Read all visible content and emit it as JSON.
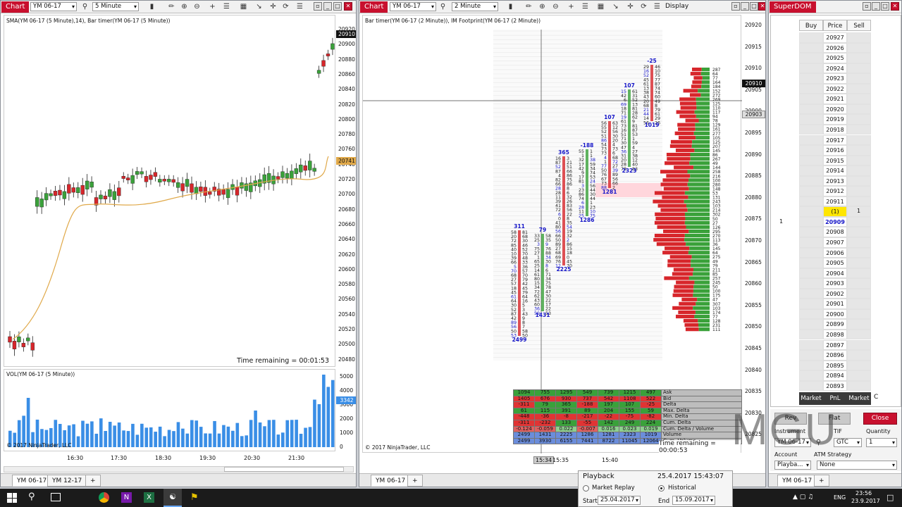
{
  "colors": {
    "accent": "#c8102e",
    "up": "#3aa13a",
    "down": "#d7262b",
    "sma": "#e0a94a",
    "vol": "#3a8ee6",
    "dom_highlight": "#ffe600"
  },
  "chart1": {
    "tag": "Chart",
    "instrument": "YM 06-17",
    "interval": "5 Minute",
    "indicators": "SMA(YM 06-17 (5 Minute),14), Bar timer(YM 06-17 (5 Minute))",
    "time_remaining": "Time remaining = 00:01:53",
    "price_ticks": [
      "20920",
      "20900",
      "20880",
      "20860",
      "20840",
      "20820",
      "20800",
      "20780",
      "20760",
      "20740",
      "20720",
      "20700",
      "20680",
      "20660",
      "20640",
      "20620",
      "20600",
      "20580",
      "20560",
      "20540",
      "20520",
      "20500",
      "20480"
    ],
    "last_price": "20910",
    "sma_price": "20741",
    "vol_title": "VOL(YM 06-17 (5 Minute))",
    "vol_ticks": [
      "5000",
      "4000",
      "3000",
      "2000",
      "1000",
      "0"
    ],
    "vol_last": "3342",
    "copyright": "© 2017 NinjaTrader, LLC",
    "time_ticks": [
      "16:30",
      "17:30",
      "18:30",
      "19:30",
      "20:30",
      "21:30"
    ],
    "tabs": [
      "YM 06-17",
      "YM 12-17"
    ]
  },
  "chart2": {
    "tag": "Chart",
    "instrument": "YM 06-17",
    "interval": "2 Minute",
    "display_label": "Display",
    "indicators": "Bar timer(YM 06-17 (2 Minute)),  IM Footprint(YM 06-17 (2 Minute))",
    "price_ticks": [
      "20920",
      "20915",
      "20910",
      "20905",
      "20900",
      "20895",
      "20890",
      "20885",
      "20880",
      "20875",
      "20870",
      "20865",
      "20860",
      "20855",
      "20850",
      "20845",
      "20840",
      "20835",
      "20830",
      "20825"
    ],
    "last_price": "20910",
    "cursor_price": "20903",
    "time_remaining": "Time remaining = 00:00:53",
    "copyright": "© 2017 NinjaTrader, LLC",
    "time_ticks": [
      "15:34",
      "15:35",
      "15:40"
    ],
    "stats_labels": [
      "Ask",
      "Bid",
      "Delta",
      "Max. Delta",
      "Min. Delta",
      "Cum. Delta",
      "Cum. Delta / Volume",
      "Volume",
      "Cum. Volume"
    ],
    "stats_rows": [
      [
        "1094",
        "755",
        "1295",
        "549",
        "739",
        "1215",
        "497"
      ],
      [
        "1405",
        "676",
        "930",
        "737",
        "542",
        "1108",
        "522"
      ],
      [
        "-311",
        "79",
        "365",
        "-188",
        "197",
        "107",
        "-25"
      ],
      [
        "61",
        "115",
        "391",
        "89",
        "204",
        "155",
        "59"
      ],
      [
        "-448",
        "-36",
        "-8",
        "-217",
        "-22",
        "-75",
        "-82"
      ],
      [
        "-311",
        "-232",
        "133",
        "-55",
        "142",
        "249",
        "224"
      ],
      [
        "-0.124",
        "-0.059",
        "0.022",
        "-0.007",
        "0.016",
        "0.023",
        "0.019"
      ],
      [
        "2499",
        "1431",
        "2225",
        "1286",
        "1281",
        "2323",
        "1019"
      ],
      [
        "2499",
        "3930",
        "6155",
        "7441",
        "8722",
        "11045",
        "12064"
      ]
    ],
    "footprint_totals": [
      {
        "top": "311",
        "bottom": "2499"
      },
      {
        "top": "79",
        "bottom": "1431"
      },
      {
        "top": "365",
        "bottom": "2225"
      },
      {
        "top": "-188",
        "bottom": "1286"
      },
      {
        "top": "107",
        "bottom": "1281"
      },
      {
        "top": "107",
        "bottom": "2323"
      },
      {
        "top": "-25",
        "bottom": "1019"
      }
    ],
    "tabs": [
      "YM 06-17"
    ],
    "playback": {
      "title": "Playback",
      "datetime": "25.4.2017 15:43:07",
      "market_replay": "Market Replay",
      "historical": "Historical",
      "start_label": "Start",
      "start": "25.04.2017",
      "end_label": "End",
      "end": "15.09.2017"
    }
  },
  "superdom": {
    "title": "SuperDOM",
    "headers": [
      "Buy",
      "Price",
      "Sell"
    ],
    "prices": [
      "20927",
      "20926",
      "20925",
      "20924",
      "20923",
      "20922",
      "20921",
      "20920",
      "20919",
      "20918",
      "20917",
      "20916",
      "20915",
      "20914",
      "20913",
      "20912",
      "20911",
      "(1) 20910",
      "20909",
      "20908",
      "20907",
      "20906",
      "20905",
      "20904",
      "20903",
      "20902",
      "20901",
      "20900",
      "20899",
      "20898",
      "20897",
      "20896",
      "20895",
      "20894",
      "20893"
    ],
    "sell_at_position": "1",
    "buy_at_best": "1",
    "bottom_labels": [
      "Market",
      "PnL",
      "Market"
    ],
    "extra": "C",
    "buttons": {
      "rev": "Rev",
      "flat": "Flat",
      "close": "Close"
    },
    "instrument_label": "Instrument",
    "instrument": "YM 06-17",
    "tif_label": "TIF",
    "tif": "GTC",
    "qty_label": "Quantity",
    "qty": "1",
    "account_label": "Account",
    "account": "Playba...",
    "atm_label": "ATM Strategy",
    "atm": "None",
    "tab": "YM 06-17",
    "watermark": "MGU"
  },
  "taskbar": {
    "lang": "ENG",
    "time": "23:56",
    "date": "23.9.2017"
  }
}
